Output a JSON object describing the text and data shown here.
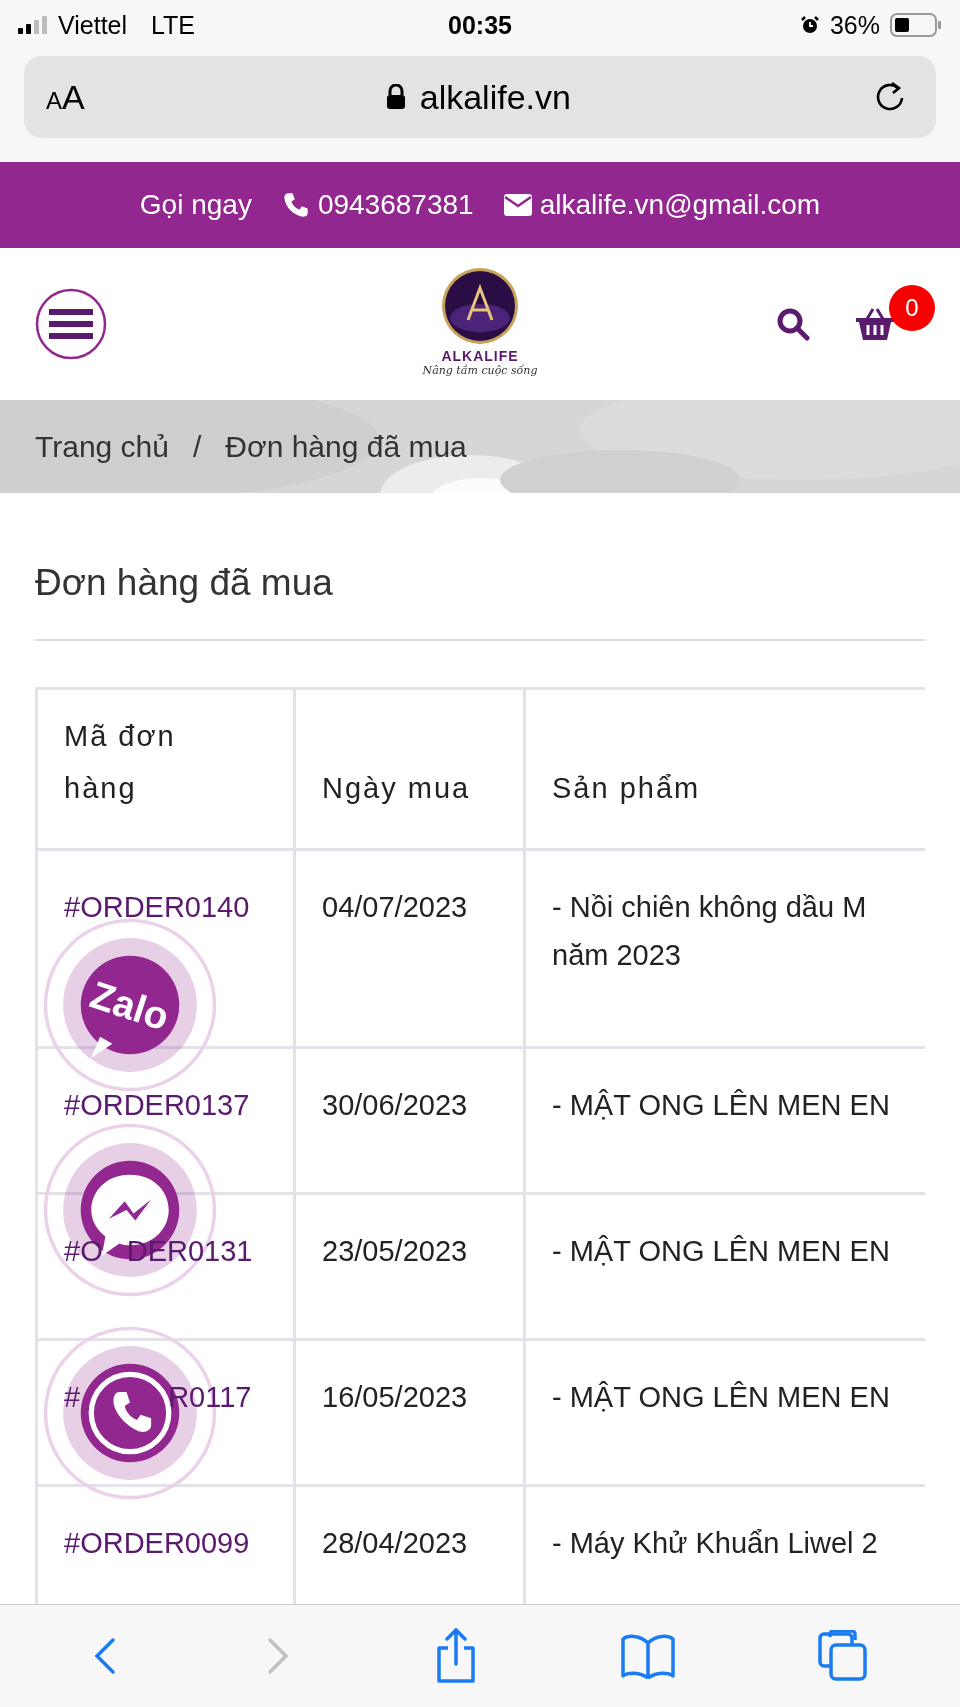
{
  "status_bar": {
    "carrier": "Viettel",
    "network": "LTE",
    "time": "00:35",
    "battery": "36%"
  },
  "address_bar": {
    "text_size_small": "A",
    "text_size_large": "A",
    "url": "alkalife.vn"
  },
  "top_bar": {
    "call_label": "Gọi ngay",
    "phone": "0943687381",
    "email": "alkalife.vn@gmail.com"
  },
  "header": {
    "brand": "ALKALIFE",
    "tagline": "Nâng tầm cuộc sống",
    "cart_count": "0"
  },
  "breadcrumb": [
    {
      "label": "Trang chủ"
    },
    {
      "label": "/"
    },
    {
      "label": "Đơn hàng đã mua"
    }
  ],
  "page_title": "Đơn hàng đã mua",
  "table": {
    "columns": [
      "Mã đơn hàng",
      "Ngày mua",
      "Sản phẩm"
    ],
    "rows": [
      {
        "order": "#ORDER0140",
        "date": "04/07/2023",
        "product": [
          "- Nồi chiên không dầu M",
          "năm 2023"
        ]
      },
      {
        "order": "#ORDER0137",
        "date": "30/06/2023",
        "product": [
          "- MẬT ONG LÊN MEN EN"
        ]
      },
      {
        "order_parts": [
          "#O",
          "DER0131"
        ],
        "date": "23/05/2023",
        "product": [
          "- MẬT ONG LÊN MEN EN"
        ]
      },
      {
        "order_parts": [
          "#",
          "R0117"
        ],
        "date": "16/05/2023",
        "product": [
          "- MẬT ONG LÊN MEN EN"
        ]
      },
      {
        "order": "#ORDER0099",
        "date": "28/04/2023",
        "product": [
          "- Máy Khử Khuẩn Liwel 2"
        ]
      }
    ]
  },
  "contact_buttons": [
    {
      "kind": "zalo",
      "label": "Zalo"
    },
    {
      "kind": "messenger"
    },
    {
      "kind": "phone"
    }
  ],
  "toolbar": [
    {
      "kind": "back",
      "disabled": false
    },
    {
      "kind": "forward",
      "disabled": true
    },
    {
      "kind": "share",
      "disabled": false
    },
    {
      "kind": "bookmarks",
      "disabled": false
    },
    {
      "kind": "tabs",
      "disabled": false
    }
  ]
}
